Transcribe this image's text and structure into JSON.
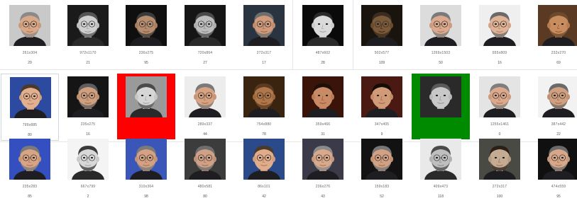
{
  "colors": {
    "background": "#ffffff",
    "selected_red": "#ff0000",
    "selected_green": "#008a00"
  },
  "rows": [
    [
      {
        "dimensions": "261x304",
        "count": "29",
        "skin": "#d9a888",
        "bg": "#c9c9c9",
        "hair": "#8a8a8a",
        "gray": false,
        "glasses": true,
        "beard": true
      },
      {
        "dimensions": "972x1170",
        "count": "21",
        "skin": "#cfcfcf",
        "bg": "#1a1a1a",
        "hair": "#555555",
        "gray": true,
        "glasses": true,
        "beard": true
      },
      {
        "dimensions": "236x275",
        "count": "95",
        "skin": "#b78d70",
        "bg": "#0f0f0f",
        "hair": "#3a3a3a",
        "gray": false,
        "glasses": true,
        "beard": true
      },
      {
        "dimensions": "720x864",
        "count": "27",
        "skin": "#bdbdbd",
        "bg": "#151515",
        "hair": "#4a4a4a",
        "gray": true,
        "glasses": true,
        "beard": true
      },
      {
        "dimensions": "272x317",
        "count": "17",
        "skin": "#d09a7c",
        "bg": "#2a3340",
        "hair": "#6e6e6e",
        "gray": false,
        "glasses": true,
        "beard": true
      },
      {
        "dimensions": "487x602",
        "count": "28",
        "skin": "#dadada",
        "bg": "#0a0a0a",
        "hair": "#2a2a2a",
        "gray": true,
        "glasses": false,
        "beard": false
      },
      {
        "dimensions": "502x577",
        "count": "109",
        "skin": "#7a5a3a",
        "bg": "#1a140e",
        "hair": "#3a2c1e",
        "gray": false,
        "glasses": true,
        "beard": true
      },
      {
        "dimensions": "1269x1503",
        "count": "50",
        "skin": "#dba98d",
        "bg": "#dcdcdc",
        "hair": "#7a7a7a",
        "gray": false,
        "glasses": true,
        "beard": true
      },
      {
        "dimensions": "655x809",
        "count": "16",
        "skin": "#e0b396",
        "bg": "#efefef",
        "hair": "#6a6a6a",
        "gray": false,
        "glasses": true,
        "beard": true
      },
      {
        "dimensions": "232x270",
        "count": "69",
        "skin": "#c98c5e",
        "bg": "#5a3a22",
        "hair": "#6b4a2e",
        "gray": false,
        "glasses": false,
        "beard": true
      }
    ],
    [
      {
        "dimensions": "799x885",
        "count": "80",
        "skin": "#e2b08f",
        "bg": "#2b4aa0",
        "hair": "#4a3a2c",
        "gray": false,
        "glasses": true,
        "beard": false,
        "state": "hover"
      },
      {
        "dimensions": "235x275",
        "count": "16",
        "skin": "#cf9f7f",
        "bg": "#151515",
        "hair": "#5e5e5e",
        "gray": false,
        "glasses": true,
        "beard": true
      },
      {
        "dimensions": "",
        "count": "",
        "skin": "#d6d6d6",
        "bg": "#9a9a9a",
        "hair": "#4a4a4a",
        "gray": true,
        "glasses": false,
        "beard": true,
        "state": "selected-red"
      },
      {
        "dimensions": "289x337",
        "count": "44",
        "skin": "#d8a383",
        "bg": "#ededed",
        "hair": "#7a7a7a",
        "gray": false,
        "glasses": true,
        "beard": true
      },
      {
        "dimensions": "754x880",
        "count": "78",
        "skin": "#b0774a",
        "bg": "#3a2410",
        "hair": "#5a3a20",
        "gray": false,
        "glasses": true,
        "beard": true
      },
      {
        "dimensions": "359x466",
        "count": "31",
        "skin": "#c98a66",
        "bg": "#3a1408",
        "hair": "#1c1008",
        "gray": false,
        "glasses": false,
        "beard": false
      },
      {
        "dimensions": "347x405",
        "count": "9",
        "skin": "#d19a78",
        "bg": "#4a1a12",
        "hair": "#150c06",
        "gray": false,
        "glasses": false,
        "beard": false
      },
      {
        "dimensions": "",
        "count": "",
        "skin": "#c8c8c8",
        "bg": "#2a2a2a",
        "hair": "#5a5a5a",
        "gray": true,
        "glasses": false,
        "beard": false,
        "state": "selected-green"
      },
      {
        "dimensions": "1255x1461",
        "count": "0",
        "skin": "#dba98b",
        "bg": "#e4e4e4",
        "hair": "#7e7e7e",
        "gray": false,
        "glasses": true,
        "beard": true
      },
      {
        "dimensions": "387x442",
        "count": "22",
        "skin": "#d0a080",
        "bg": "#f2f2f2",
        "hair": "#6a6a6a",
        "gray": false,
        "glasses": true,
        "beard": true
      }
    ],
    [
      {
        "dimensions": "235x283",
        "count": "85",
        "skin": "#d7a586",
        "bg": "#3450c0",
        "hair": "#7a7a7a",
        "gray": false,
        "glasses": true,
        "beard": true
      },
      {
        "dimensions": "667x799",
        "count": "2",
        "skin": "#d8d8d8",
        "bg": "#f4f4f4",
        "hair": "#3a3a3a",
        "gray": true,
        "glasses": true,
        "beard": true
      },
      {
        "dimensions": "310x364",
        "count": "98",
        "skin": "#d3a184",
        "bg": "#3a56b8",
        "hair": "#7a7a7a",
        "gray": false,
        "glasses": true,
        "beard": true
      },
      {
        "dimensions": "480x581",
        "count": "80",
        "skin": "#cfa186",
        "bg": "#3c3c3c",
        "hair": "#6e6e6e",
        "gray": false,
        "glasses": true,
        "beard": true
      },
      {
        "dimensions": "86x101",
        "count": "42",
        "skin": "#e0ac8c",
        "bg": "#2a4a8a",
        "hair": "#4a3a2a",
        "gray": false,
        "glasses": true,
        "beard": false
      },
      {
        "dimensions": "236x276",
        "count": "43",
        "skin": "#d9a98b",
        "bg": "#3a3a48",
        "hair": "#8a8a8a",
        "gray": false,
        "glasses": true,
        "beard": true
      },
      {
        "dimensions": "159x183",
        "count": "52",
        "skin": "#d2a184",
        "bg": "#121212",
        "hair": "#777777",
        "gray": false,
        "glasses": true,
        "beard": true
      },
      {
        "dimensions": "409x473",
        "count": "118",
        "skin": "#bfbfbf",
        "bg": "#e9e9e9",
        "hair": "#4a4a4a",
        "gray": true,
        "glasses": true,
        "beard": true
      },
      {
        "dimensions": "272x317",
        "count": "100",
        "skin": "#c4ab92",
        "bg": "#4a4a44",
        "hair": "#2a2016",
        "gray": false,
        "glasses": false,
        "beard": true
      },
      {
        "dimensions": "474x559",
        "count": "95",
        "skin": "#d6a789",
        "bg": "#101010",
        "hair": "#6a6a6a",
        "gray": false,
        "glasses": true,
        "beard": true
      }
    ]
  ]
}
